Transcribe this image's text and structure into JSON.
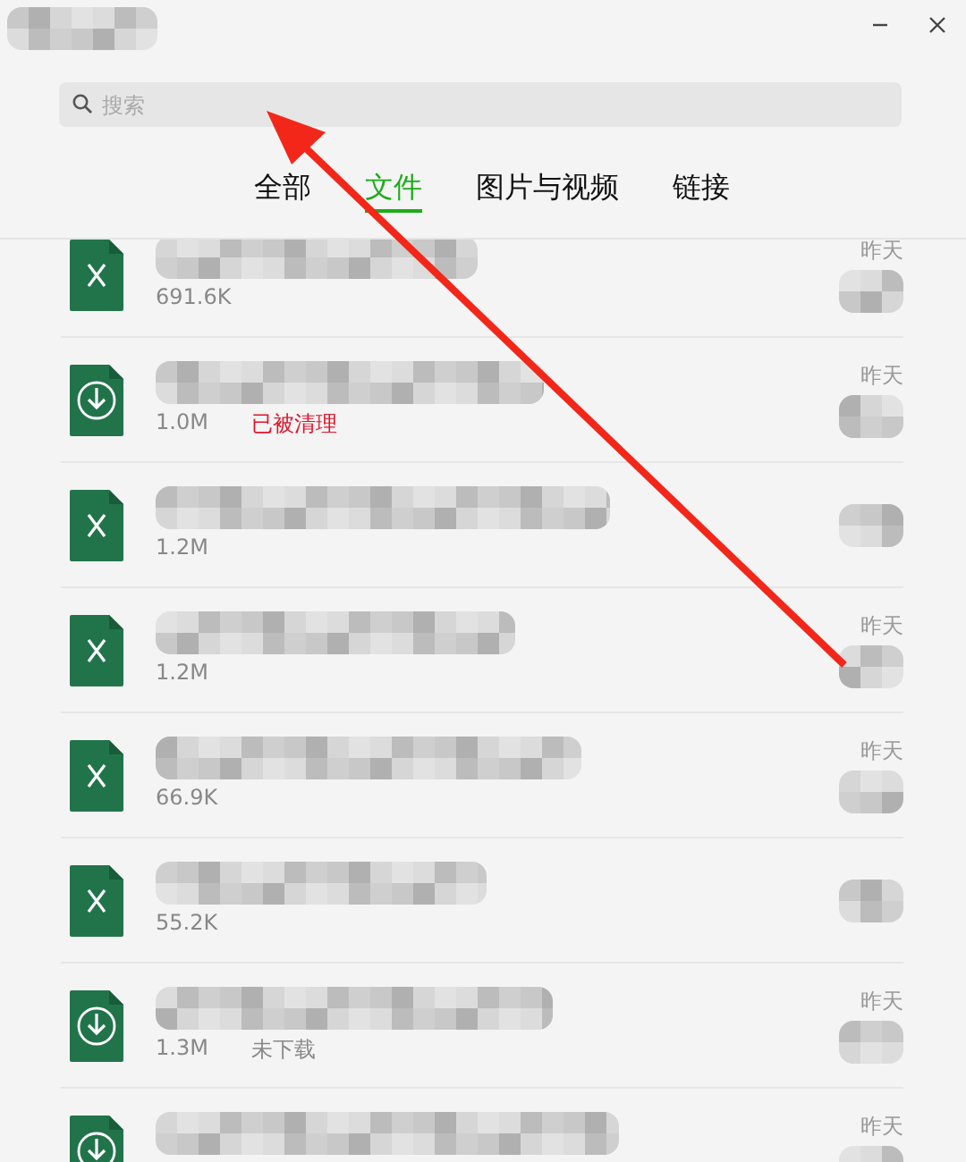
{
  "window": {
    "controls": [
      {
        "kind": "minimize"
      },
      {
        "kind": "close"
      }
    ]
  },
  "search": {
    "placeholder": "搜索"
  },
  "tabs": [
    {
      "label": "全部",
      "selected": false
    },
    {
      "label": "文件",
      "selected": true
    },
    {
      "label": "图片与视频",
      "selected": false
    },
    {
      "label": "链接",
      "selected": false
    }
  ],
  "files": [
    {
      "kind": "excel",
      "size": "691.6K",
      "date": "昨天"
    },
    {
      "kind": "download",
      "size": "1.0M",
      "status": {
        "kind": "cleared",
        "text": "已被清理"
      },
      "date": "昨天"
    },
    {
      "kind": "excel",
      "size": "1.2M"
    },
    {
      "kind": "excel",
      "size": "1.2M",
      "date": "昨天"
    },
    {
      "kind": "excel",
      "size": "66.9K",
      "date": "昨天"
    },
    {
      "kind": "excel",
      "size": "55.2K"
    },
    {
      "kind": "download",
      "size": "1.3M",
      "status": {
        "kind": "pending",
        "text": "未下载"
      },
      "date": "昨天"
    },
    {
      "kind": "download",
      "date": "昨天"
    }
  ]
}
